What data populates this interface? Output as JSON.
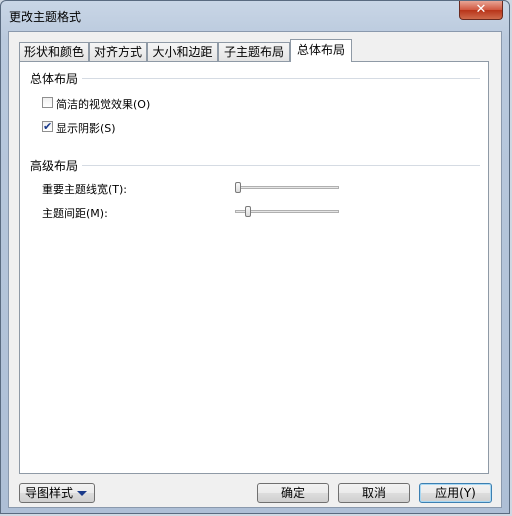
{
  "window": {
    "title": "更改主题格式",
    "close_glyph": "✕"
  },
  "tabs": [
    {
      "label": "形状和颜色"
    },
    {
      "label": "对齐方式"
    },
    {
      "label": "大小和边距"
    },
    {
      "label": "子主题布局"
    },
    {
      "label": "总体布局",
      "active": true
    }
  ],
  "general_layout": {
    "title": "总体布局",
    "clean_visual": {
      "label": "简洁的视觉效果(O)",
      "checked": false
    },
    "show_shadow": {
      "label": "显示阴影(S)",
      "checked": true,
      "check_glyph": "✔"
    }
  },
  "advanced_layout": {
    "title": "高级布局",
    "main_topic_line_width": {
      "label": "重要主题线宽(T):",
      "value": 0
    },
    "topic_spacing": {
      "label": "主题间距(M):",
      "value": 0.1
    }
  },
  "footer": {
    "map_style_label": "导图样式",
    "ok_label": "确定",
    "cancel_label": "取消",
    "apply_label": "应用(Y)"
  }
}
